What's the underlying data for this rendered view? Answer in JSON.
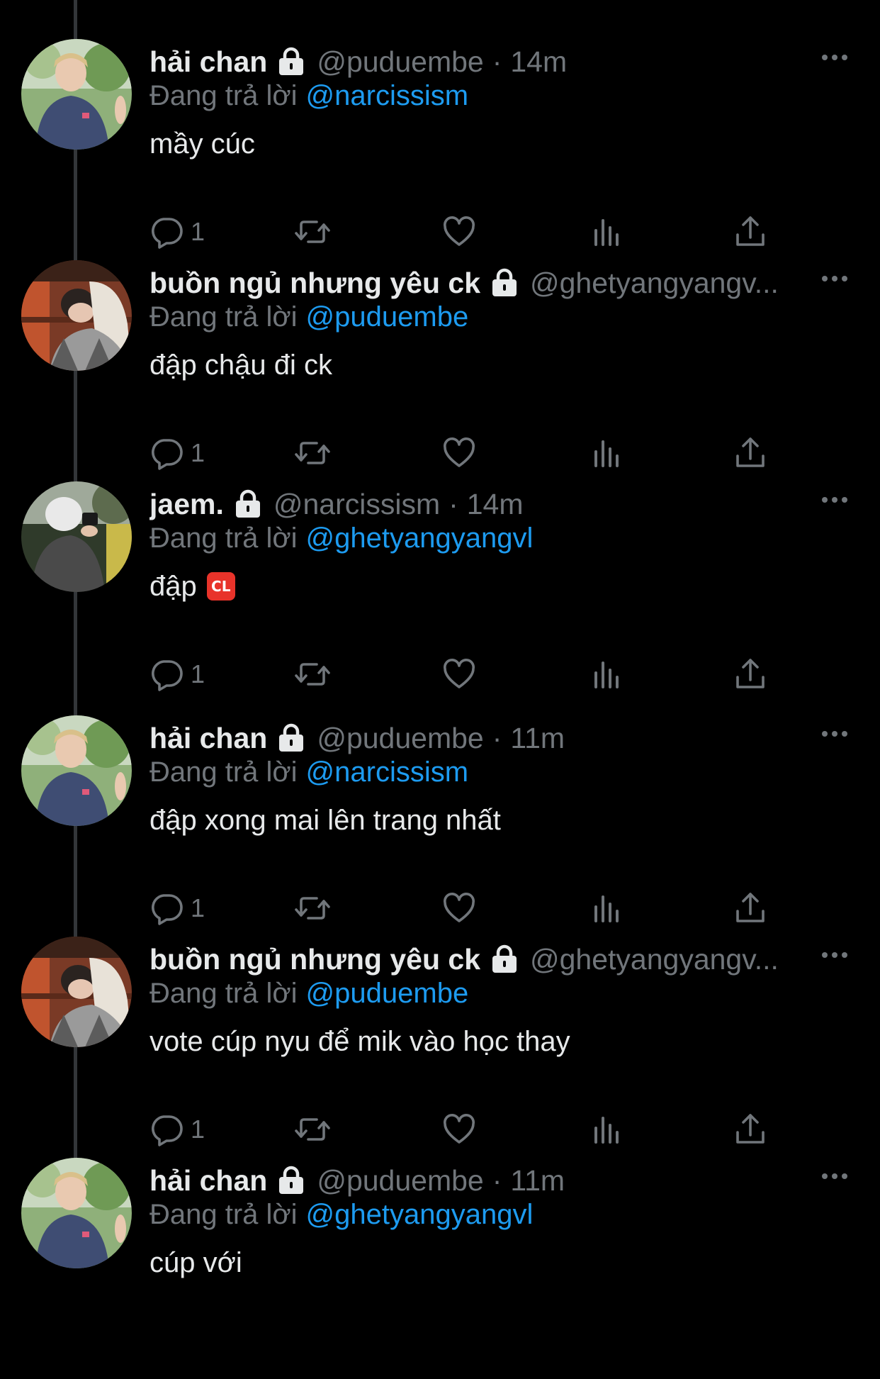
{
  "colors": {
    "background": "#000000",
    "primary_text": "#e7e9ea",
    "secondary_text": "#71767b",
    "link": "#1d9bf0",
    "thread_line": "#333639"
  },
  "reply_prefix": "Đang trả lời",
  "tweets": [
    {
      "name": "hải chan",
      "handle": "@puduembe",
      "time": "14m",
      "reply_to": "@narcissism",
      "text": "mầy cúc",
      "reply_count": "1"
    },
    {
      "name": "buồn ngủ nhưng yêu ck",
      "handle": "@ghetyangyangv...",
      "time": "",
      "reply_to": "@puduembe",
      "text": "đập chậu đi ck",
      "reply_count": "1"
    },
    {
      "name": "jaem.",
      "handle": "@narcissism",
      "time": "14m",
      "reply_to": "@ghetyangyangvl",
      "text": "đập",
      "emoji": "CL",
      "reply_count": "1"
    },
    {
      "name": "hải chan",
      "handle": "@puduembe",
      "time": "11m",
      "reply_to": "@narcissism",
      "text": "đập xong mai lên trang nhất",
      "reply_count": "1"
    },
    {
      "name": "buồn ngủ nhưng yêu ck",
      "handle": "@ghetyangyangv...",
      "time": "",
      "reply_to": "@puduembe",
      "text": "vote cúp nyu để mik vào học thay",
      "reply_count": "1"
    },
    {
      "name": "hải chan",
      "handle": "@puduembe",
      "time": "11m",
      "reply_to": "@ghetyangyangvl",
      "text": "cúp với",
      "reply_count": ""
    }
  ],
  "icons": {
    "lock": "lock-icon",
    "more": "more-icon",
    "reply": "reply-icon",
    "retweet": "retweet-icon",
    "like": "like-icon",
    "views": "views-icon",
    "share": "share-icon"
  }
}
